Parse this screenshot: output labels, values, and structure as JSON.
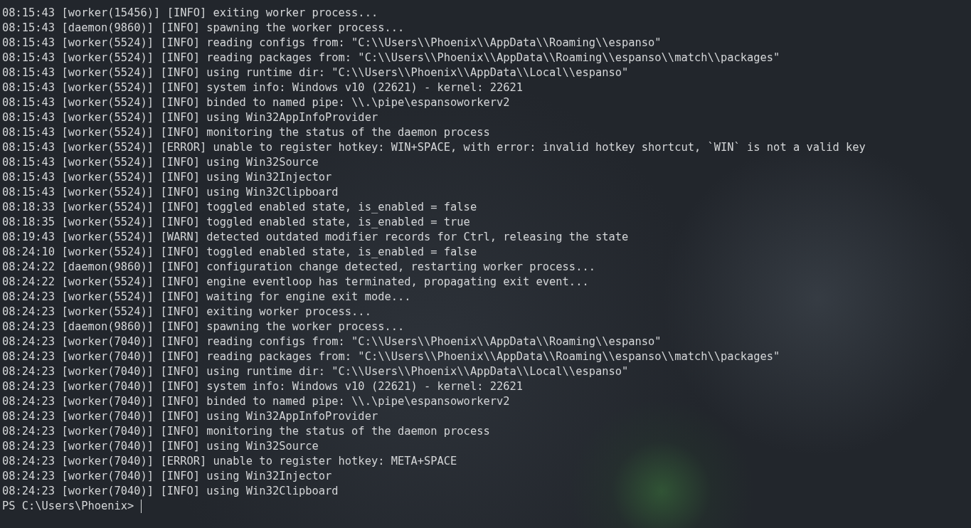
{
  "log_lines": [
    "08:15:43 [worker(15456)] [INFO] exiting worker process...",
    "08:15:43 [daemon(9860)] [INFO] spawning the worker process...",
    "08:15:43 [worker(5524)] [INFO] reading configs from: \"C:\\\\Users\\\\Phoenix\\\\AppData\\\\Roaming\\\\espanso\"",
    "08:15:43 [worker(5524)] [INFO] reading packages from: \"C:\\\\Users\\\\Phoenix\\\\AppData\\\\Roaming\\\\espanso\\\\match\\\\packages\"",
    "08:15:43 [worker(5524)] [INFO] using runtime dir: \"C:\\\\Users\\\\Phoenix\\\\AppData\\\\Local\\\\espanso\"",
    "08:15:43 [worker(5524)] [INFO] system info: Windows v10 (22621) - kernel: 22621",
    "08:15:43 [worker(5524)] [INFO] binded to named pipe: \\\\.\\pipe\\espansoworkerv2",
    "08:15:43 [worker(5524)] [INFO] using Win32AppInfoProvider",
    "08:15:43 [worker(5524)] [INFO] monitoring the status of the daemon process",
    "08:15:43 [worker(5524)] [ERROR] unable to register hotkey: WIN+SPACE, with error: invalid hotkey shortcut, `WIN` is not a valid key",
    "08:15:43 [worker(5524)] [INFO] using Win32Source",
    "08:15:43 [worker(5524)] [INFO] using Win32Injector",
    "08:15:43 [worker(5524)] [INFO] using Win32Clipboard",
    "08:18:33 [worker(5524)] [INFO] toggled enabled state, is_enabled = false",
    "08:18:35 [worker(5524)] [INFO] toggled enabled state, is_enabled = true",
    "08:19:43 [worker(5524)] [WARN] detected outdated modifier records for Ctrl, releasing the state",
    "08:24:10 [worker(5524)] [INFO] toggled enabled state, is_enabled = false",
    "08:24:22 [daemon(9860)] [INFO] configuration change detected, restarting worker process...",
    "08:24:22 [worker(5524)] [INFO] engine eventloop has terminated, propagating exit event...",
    "08:24:23 [worker(5524)] [INFO] waiting for engine exit mode...",
    "08:24:23 [worker(5524)] [INFO] exiting worker process...",
    "08:24:23 [daemon(9860)] [INFO] spawning the worker process...",
    "08:24:23 [worker(7040)] [INFO] reading configs from: \"C:\\\\Users\\\\Phoenix\\\\AppData\\\\Roaming\\\\espanso\"",
    "08:24:23 [worker(7040)] [INFO] reading packages from: \"C:\\\\Users\\\\Phoenix\\\\AppData\\\\Roaming\\\\espanso\\\\match\\\\packages\"",
    "08:24:23 [worker(7040)] [INFO] using runtime dir: \"C:\\\\Users\\\\Phoenix\\\\AppData\\\\Local\\\\espanso\"",
    "08:24:23 [worker(7040)] [INFO] system info: Windows v10 (22621) - kernel: 22621",
    "08:24:23 [worker(7040)] [INFO] binded to named pipe: \\\\.\\pipe\\espansoworkerv2",
    "08:24:23 [worker(7040)] [INFO] using Win32AppInfoProvider",
    "08:24:23 [worker(7040)] [INFO] monitoring the status of the daemon process",
    "08:24:23 [worker(7040)] [INFO] using Win32Source",
    "08:24:23 [worker(7040)] [ERROR] unable to register hotkey: META+SPACE",
    "08:24:23 [worker(7040)] [INFO] using Win32Injector",
    "08:24:23 [worker(7040)] [INFO] using Win32Clipboard"
  ],
  "prompt": "PS C:\\Users\\Phoenix>"
}
